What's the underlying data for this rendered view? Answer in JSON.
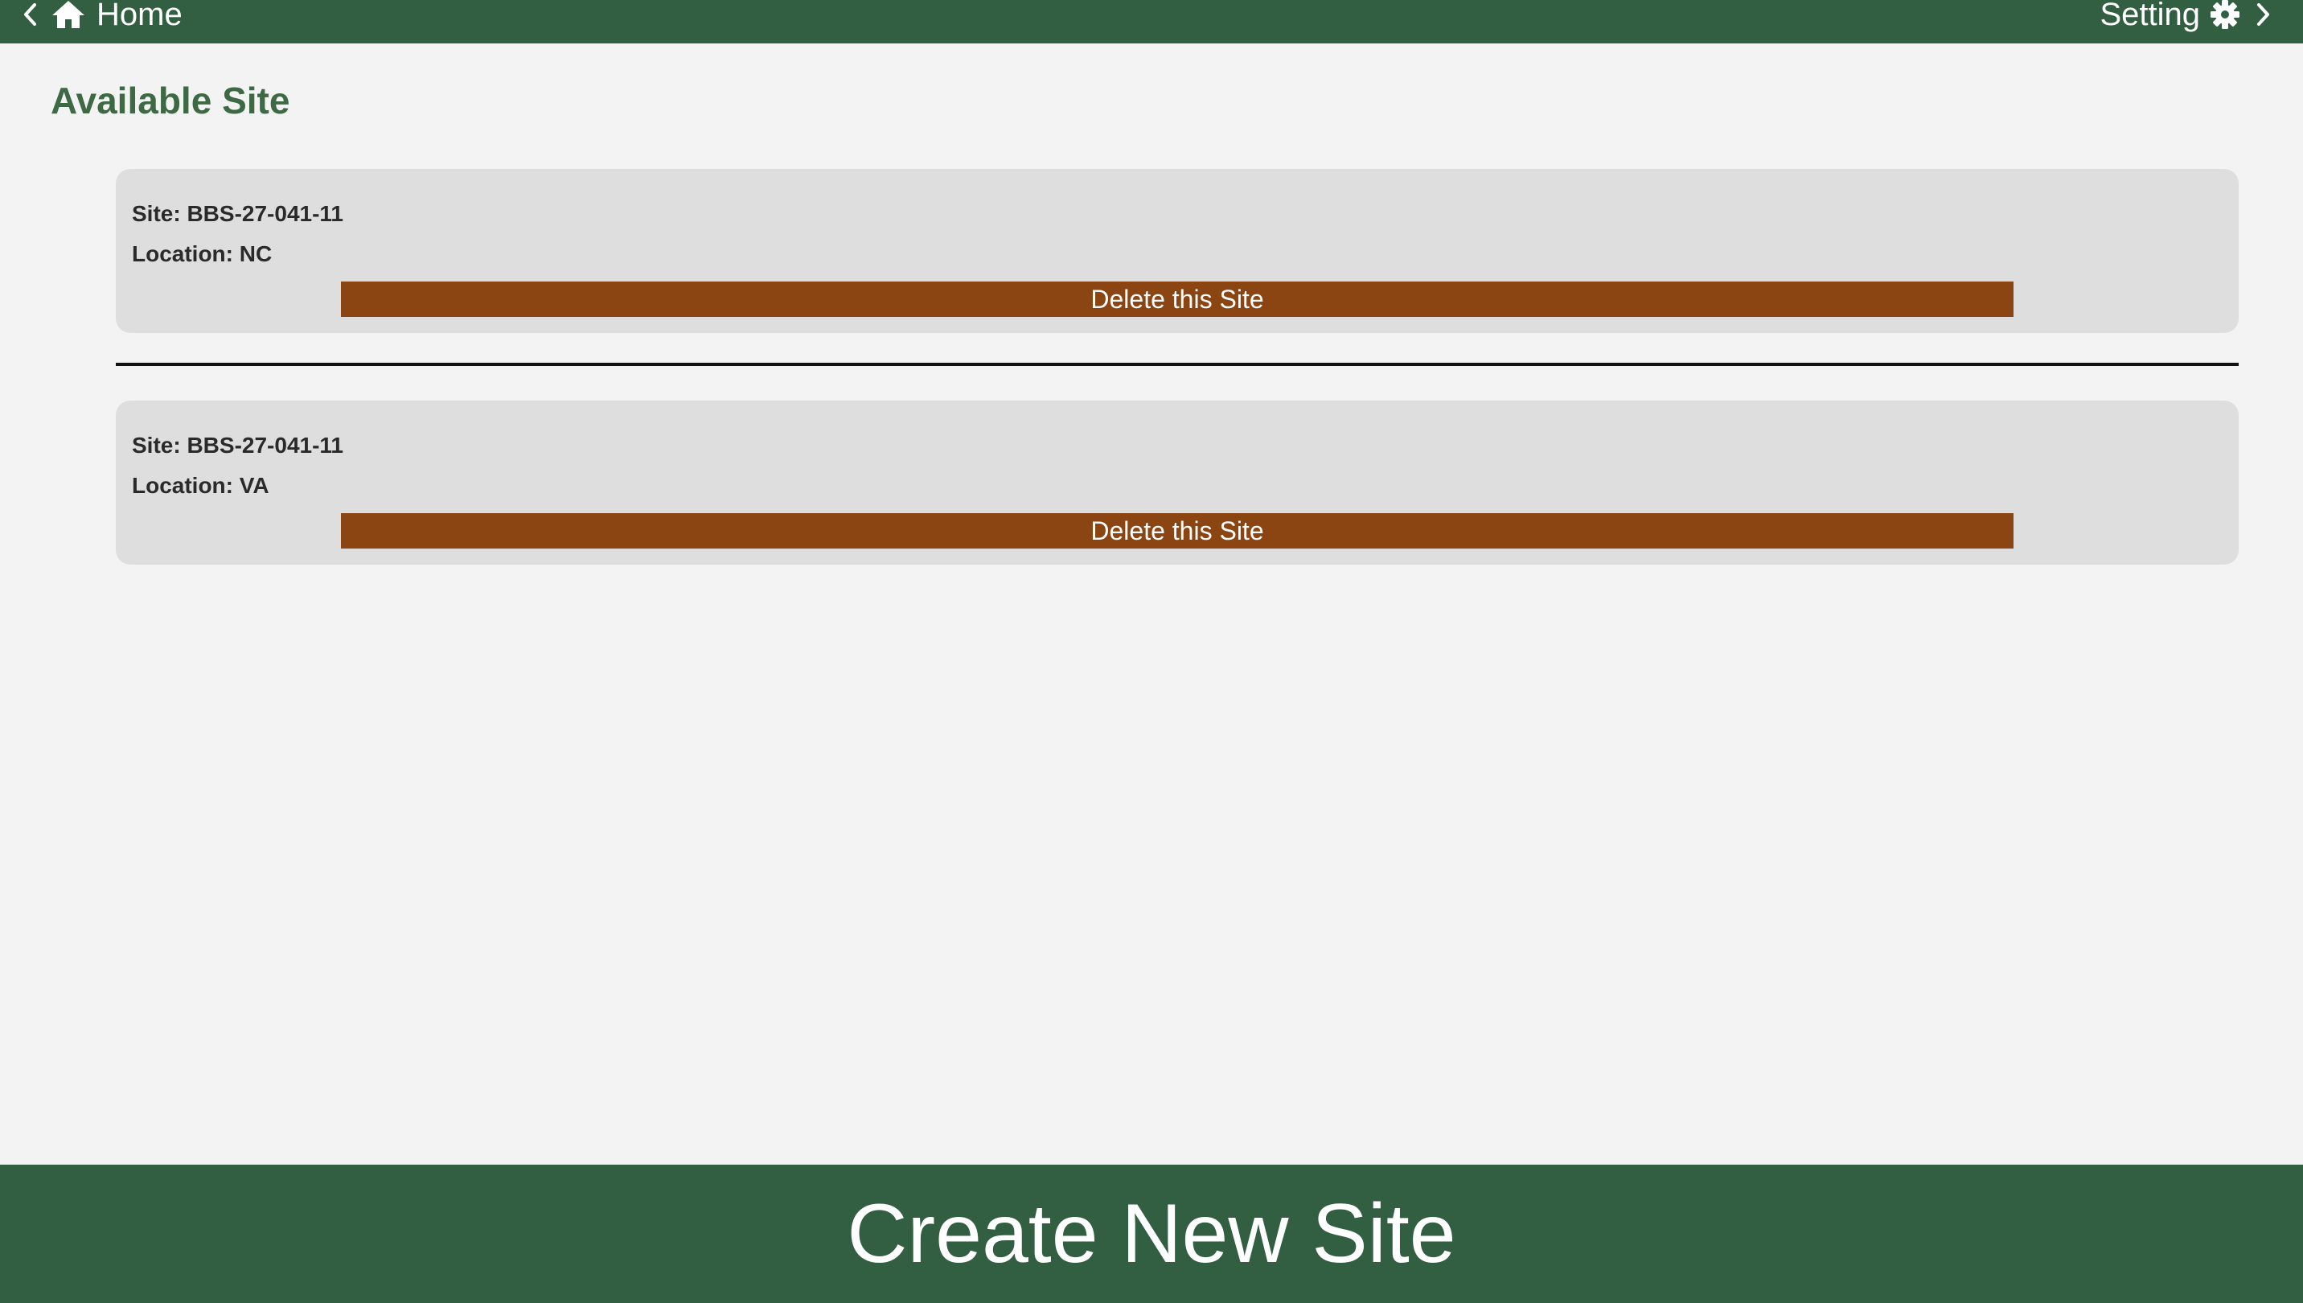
{
  "header": {
    "home_label": "Home",
    "setting_label": "Setting",
    "icons": {
      "back": "chevron-left-icon",
      "home": "home-icon",
      "setting": "gear-icon",
      "forward": "chevron-right-icon"
    }
  },
  "main": {
    "title": "Available Site",
    "sites": [
      {
        "site": "Site: BBS-27-041-11",
        "location": "Location: NC",
        "delete_label": "Delete this Site"
      },
      {
        "site": "Site: BBS-27-041-11",
        "location": "Location: VA",
        "delete_label": "Delete this Site"
      }
    ]
  },
  "footer": {
    "create_label": "Create New Site"
  },
  "colors": {
    "brand_green": "#325e41",
    "title_green": "#3d6a44",
    "delete_brown": "#8b4513",
    "card_gray": "#dedede",
    "background": "#f3f3f3"
  }
}
